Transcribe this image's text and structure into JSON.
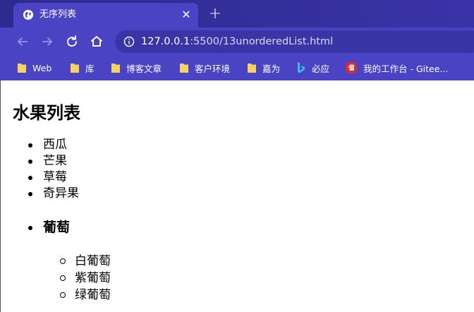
{
  "browser": {
    "tab": {
      "title": "无序列表",
      "favicon": "globe-icon",
      "close_icon": "close-icon"
    },
    "new_tab_icon": "plus-icon",
    "toolbar": {
      "back_icon": "arrow-left-icon",
      "forward_icon": "arrow-right-icon",
      "reload_icon": "reload-icon",
      "home_icon": "home-icon"
    },
    "address": {
      "icon": "info-icon",
      "host": "127.0.0.1",
      "rest": ":5500/13unorderedList.html"
    },
    "bookmarks": [
      {
        "label": "Web",
        "icon": "folder-icon"
      },
      {
        "label": "库",
        "icon": "folder-icon"
      },
      {
        "label": "博客文章",
        "icon": "folder-icon"
      },
      {
        "label": "客户环境",
        "icon": "folder-icon"
      },
      {
        "label": "嘉为",
        "icon": "folder-icon"
      },
      {
        "label": "必应",
        "icon": "bing-icon"
      },
      {
        "label": "我的工作台 - Gitee...",
        "icon": "gitee-icon"
      }
    ]
  },
  "page": {
    "heading": "水果列表",
    "fruits": [
      "西瓜",
      "芒果",
      "草莓",
      "奇异果"
    ],
    "grape_title": "葡萄",
    "grapes": [
      "白葡萄",
      "紫葡萄",
      "绿葡萄"
    ]
  },
  "colors": {
    "chrome": "#4a44c4",
    "tabstrip": "#2f2a8f",
    "omnibox": "#3a35a6"
  }
}
